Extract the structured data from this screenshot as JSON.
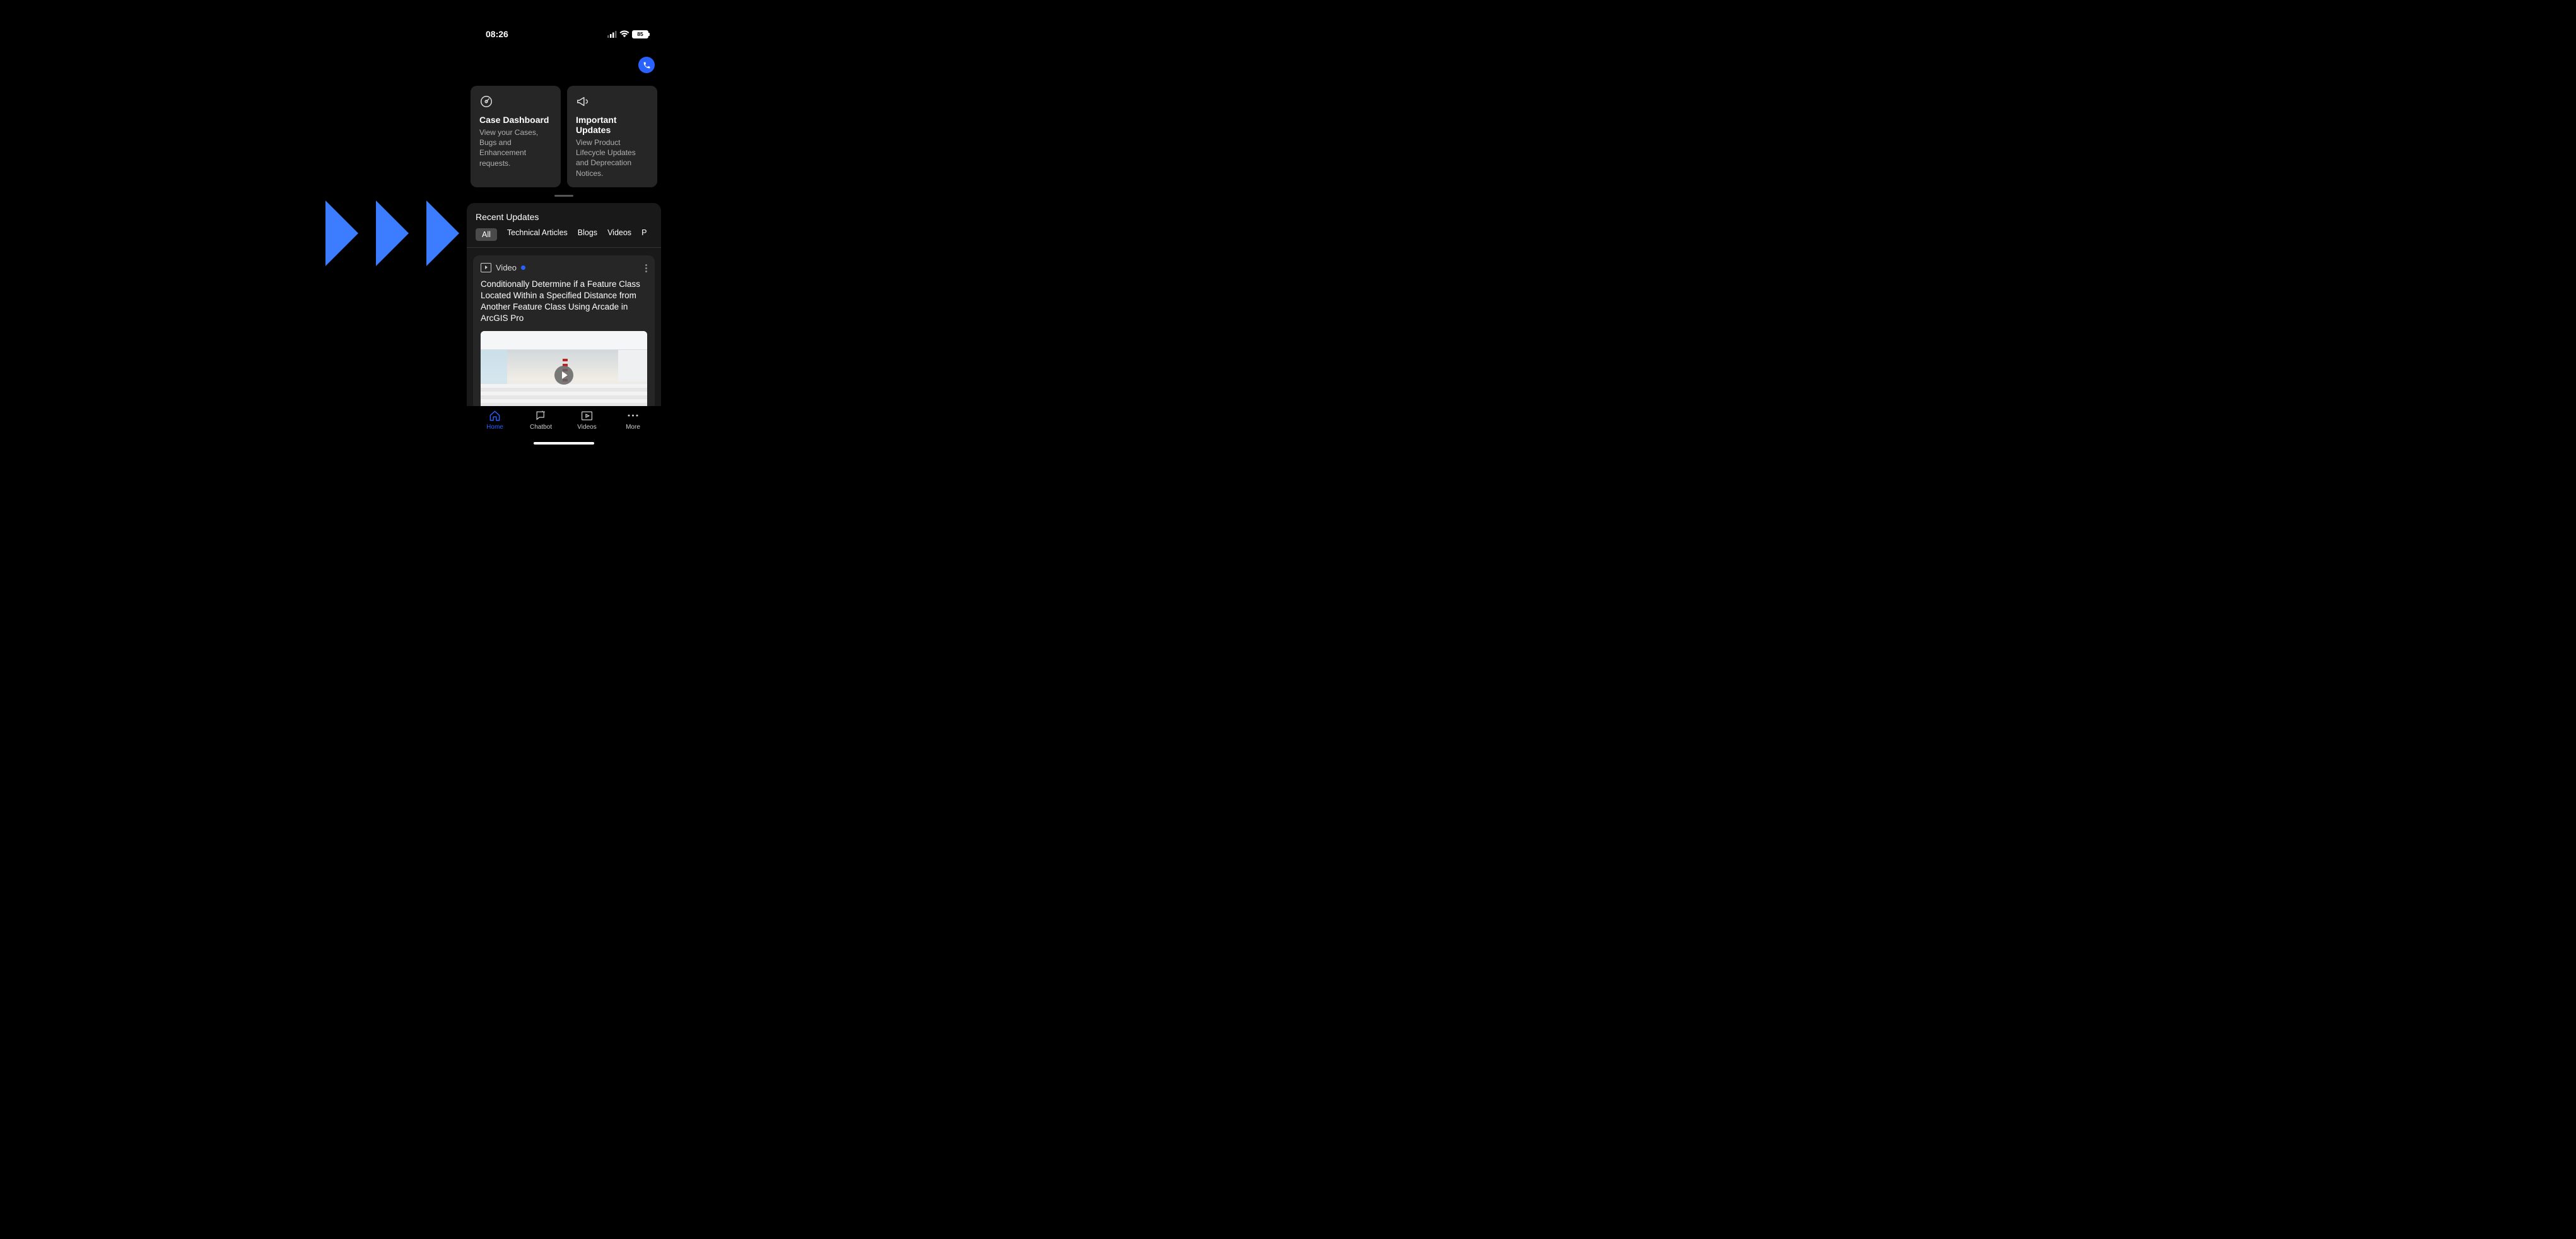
{
  "status": {
    "time": "08:26",
    "battery": "85"
  },
  "cards": [
    {
      "title": "Case Dashboard",
      "desc": "View your Cases, Bugs and Enhancement requests."
    },
    {
      "title": "Important Updates",
      "desc": "View Product Lifecycle Updates and Deprecation Notices."
    }
  ],
  "section": {
    "title": "Recent Updates"
  },
  "tabs": [
    "All",
    "Technical Articles",
    "Blogs",
    "Videos",
    "P"
  ],
  "video": {
    "badge": "Video",
    "title": "Conditionally Determine if a Feature Class Located Within a Specified Distance from Another Feature Class Using Arcade in ArcGIS Pro"
  },
  "nav": [
    {
      "label": "Home"
    },
    {
      "label": "Chatbot"
    },
    {
      "label": "Videos"
    },
    {
      "label": "More"
    }
  ]
}
